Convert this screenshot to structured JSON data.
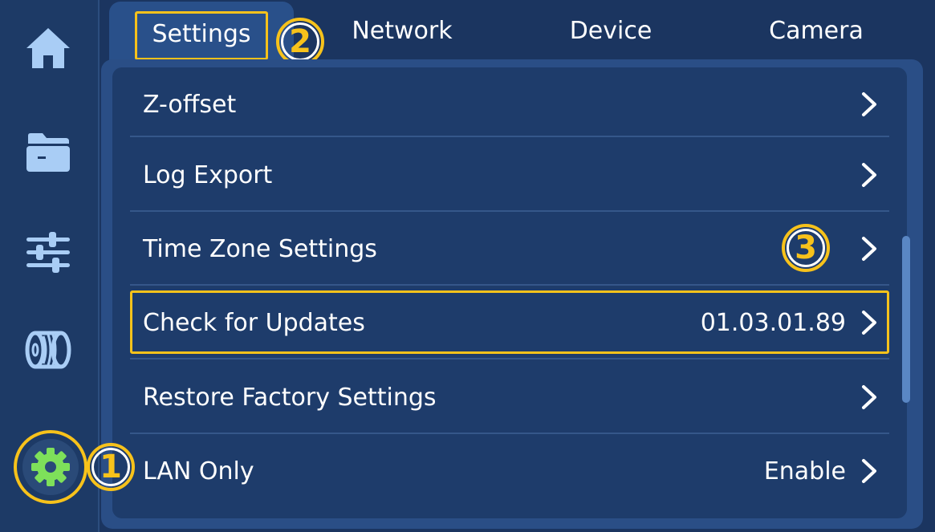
{
  "tabs": {
    "settings": "Settings",
    "network": "Network",
    "device": "Device",
    "camera": "Camera"
  },
  "badges": {
    "one": "1",
    "two": "2",
    "three": "3"
  },
  "sidebar": {
    "items": [
      "home-icon",
      "folder-icon",
      "sliders-icon",
      "filament-spool-icon",
      "gear-icon"
    ]
  },
  "rows": [
    {
      "label": "Z-offset",
      "value": ""
    },
    {
      "label": "Log Export",
      "value": ""
    },
    {
      "label": "Time Zone Settings",
      "value": ""
    },
    {
      "label": "Check for Updates",
      "value": "01.03.01.89"
    },
    {
      "label": "Restore Factory Settings",
      "value": ""
    },
    {
      "label": "LAN Only",
      "value": "Enable"
    }
  ],
  "colors": {
    "background": "#1b3560",
    "panel": "#1e3c6b",
    "highlight": "#f7c21b",
    "gear_active": "#7ee05a"
  }
}
